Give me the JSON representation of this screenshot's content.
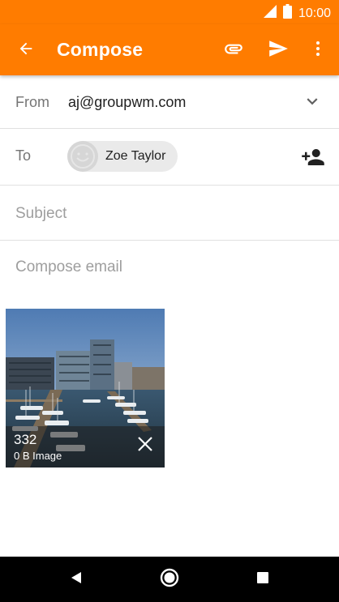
{
  "status_bar": {
    "time": "10:00"
  },
  "app_bar": {
    "title": "Compose",
    "icons": [
      "back-arrow-icon",
      "paperclip-icon",
      "send-icon",
      "more-vertical-icon"
    ]
  },
  "from": {
    "label": "From",
    "value": "aj@groupwm.com"
  },
  "to": {
    "label": "To",
    "recipients": [
      {
        "name": "Zoe Taylor"
      }
    ]
  },
  "subject": {
    "placeholder": "Subject"
  },
  "body": {
    "placeholder": "Compose email"
  },
  "attachment": {
    "name": "332",
    "size": "0 B Image"
  },
  "colors": {
    "accent": "#ff7c00",
    "divider": "#e0e0e0",
    "chip": "#eaeaea"
  }
}
